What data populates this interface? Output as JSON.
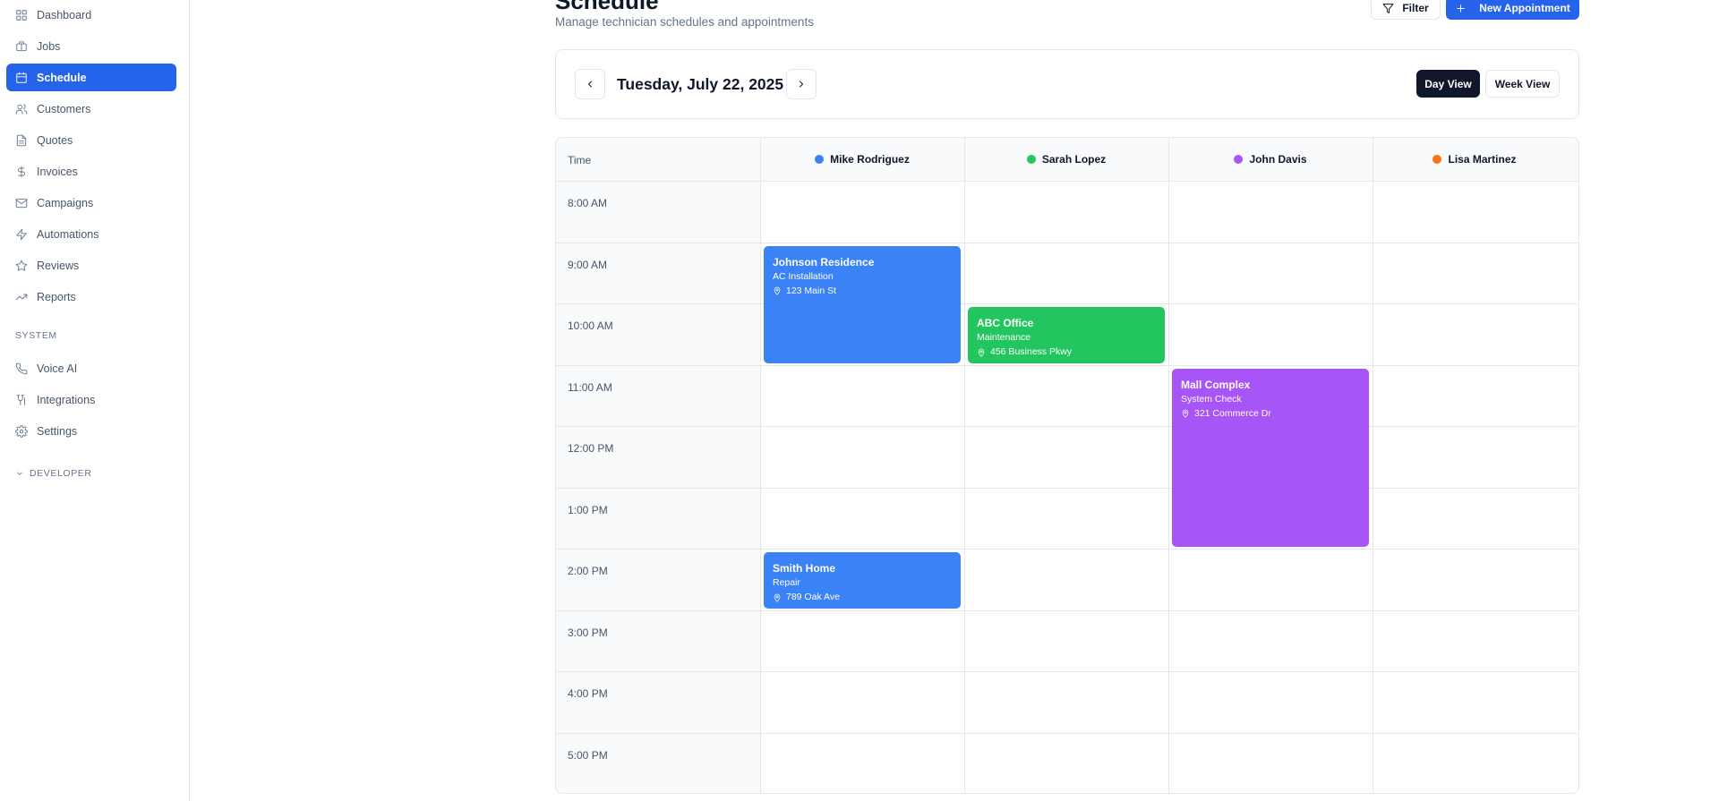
{
  "sidebar": {
    "items": [
      {
        "label": "Dashboard",
        "icon": "grid-icon"
      },
      {
        "label": "Jobs",
        "icon": "briefcase-icon"
      },
      {
        "label": "Schedule",
        "icon": "calendar-icon",
        "active": true
      },
      {
        "label": "Customers",
        "icon": "users-icon"
      },
      {
        "label": "Quotes",
        "icon": "file-icon"
      },
      {
        "label": "Invoices",
        "icon": "dollar-icon"
      },
      {
        "label": "Campaigns",
        "icon": "mail-icon"
      },
      {
        "label": "Automations",
        "icon": "zap-icon"
      },
      {
        "label": "Reviews",
        "icon": "star-icon"
      },
      {
        "label": "Reports",
        "icon": "trending-up-icon"
      }
    ],
    "system_label": "SYSTEM",
    "system_items": [
      {
        "label": "Voice AI",
        "icon": "phone-icon"
      },
      {
        "label": "Integrations",
        "icon": "plug-icon"
      },
      {
        "label": "Settings",
        "icon": "gear-icon"
      }
    ],
    "developer_label": "DEVELOPER"
  },
  "header": {
    "title": "Schedule",
    "subtitle": "Manage technician schedules and appointments",
    "filter_label": "Filter",
    "new_label": "New Appointment"
  },
  "date_nav": {
    "date": "Tuesday, July 22, 2025",
    "day_view": "Day View",
    "week_view": "Week View",
    "active_view": "Day View"
  },
  "grid": {
    "time_header": "Time",
    "technicians": [
      {
        "name": "Mike Rodriguez",
        "color": "#3b82f6"
      },
      {
        "name": "Sarah Lopez",
        "color": "#22c55e"
      },
      {
        "name": "John Davis",
        "color": "#a855f7"
      },
      {
        "name": "Lisa Martinez",
        "color": "#f97316"
      }
    ],
    "times": [
      "8:00 AM",
      "9:00 AM",
      "10:00 AM",
      "11:00 AM",
      "12:00 PM",
      "1:00 PM",
      "2:00 PM",
      "3:00 PM",
      "4:00 PM",
      "5:00 PM"
    ]
  },
  "appointments": [
    {
      "title": "Johnson Residence",
      "type": "AC Installation",
      "address": "123 Main St",
      "technician": "Mike Rodriguez",
      "start": "9:00 AM",
      "end": "11:00 AM",
      "color": "#3b82f6"
    },
    {
      "title": "ABC Office",
      "type": "Maintenance",
      "address": "456 Business Pkwy",
      "technician": "Sarah Lopez",
      "start": "10:00 AM",
      "end": "11:00 AM",
      "color": "#22c55e"
    },
    {
      "title": "Mall Complex",
      "type": "System Check",
      "address": "321 Commerce Dr",
      "technician": "John Davis",
      "start": "11:00 AM",
      "end": "2:00 PM",
      "color": "#a855f7"
    },
    {
      "title": "Smith Home",
      "type": "Repair",
      "address": "789 Oak Ave",
      "technician": "Mike Rodriguez",
      "start": "2:00 PM",
      "end": "3:00 PM",
      "color": "#3b82f6"
    }
  ]
}
